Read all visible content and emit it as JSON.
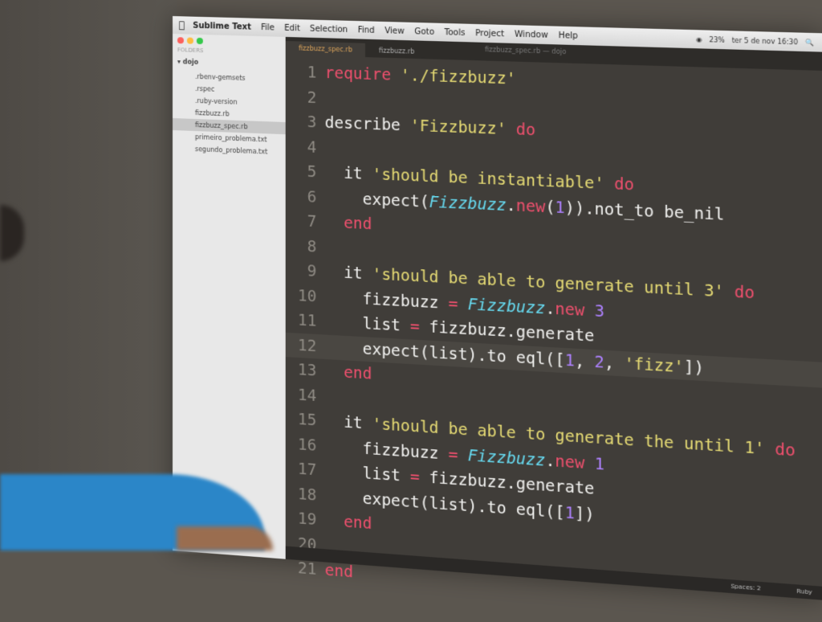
{
  "menubar": {
    "app": "Sublime Text",
    "items": [
      "File",
      "Edit",
      "Selection",
      "Find",
      "View",
      "Goto",
      "Tools",
      "Project",
      "Window",
      "Help"
    ],
    "battery": "23%",
    "clock": "ter 5 de nov 16:30"
  },
  "window": {
    "title": "fizzbuzz_spec.rb — dojo"
  },
  "sidebar": {
    "heading": "FOLDERS",
    "folder": "dojo",
    "files": [
      ".rbenv-gemsets",
      ".rspec",
      ".ruby-version",
      "fizzbuzz.rb",
      "fizzbuzz_spec.rb",
      "primeiro_problema.txt",
      "segundo_problema.txt"
    ],
    "active_index": 4
  },
  "tabs": [
    "fizzbuzz_spec.rb",
    "fizzbuzz.rb"
  ],
  "code": {
    "line_numbers": [
      "1",
      "2",
      "3",
      "4",
      "5",
      "6",
      "7",
      "8",
      "9",
      "10",
      "11",
      "12",
      "13",
      "14",
      "15",
      "16",
      "17",
      "18",
      "19",
      "20",
      "21"
    ],
    "highlighted_line": 12,
    "tokens": [
      "require",
      "'./fizzbuzz'",
      "describe ",
      "'Fizzbuzz'",
      " do",
      "  it ",
      "'should be instantiable'",
      " do",
      "    expect(",
      "Fizzbuzz",
      ".",
      "new",
      "(",
      "1",
      ")).not_to be_nil",
      "  end",
      "  it ",
      "'should be able to generate until 3'",
      " do",
      "    fizzbuzz ",
      "=",
      " ",
      "Fizzbuzz",
      ".",
      "new",
      " ",
      "3",
      "    list ",
      "=",
      " fizzbuzz.generate",
      "    expect(list).to eql([",
      "1",
      ", ",
      "2",
      ", ",
      "'fizz'",
      "])",
      "  end",
      "  it ",
      "'should be able to generate the until 1'",
      " do",
      "    fizzbuzz ",
      "=",
      " ",
      "Fizzbuzz",
      ".",
      "new",
      " ",
      "1",
      "    list ",
      "=",
      " fizzbuzz.generate",
      "    expect(list).to eql([",
      "1",
      "])",
      "  end",
      "end"
    ]
  },
  "status": {
    "spaces": "Spaces: 2",
    "syntax": "Ruby"
  },
  "colors": {
    "keyword": "#f0506e",
    "string": "#e6db74",
    "class": "#66d9ef",
    "number": "#ae81ff",
    "editor_bg": "#403d39"
  }
}
